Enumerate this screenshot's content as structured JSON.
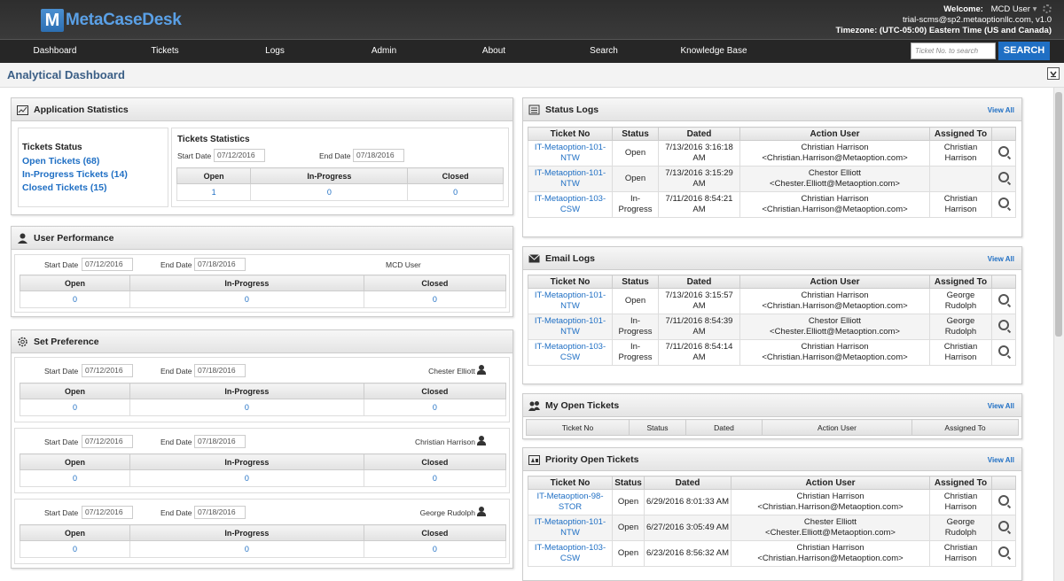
{
  "app": {
    "logo_letter": "M",
    "logo_text": "MetaCaseDesk"
  },
  "user": {
    "welcome_label": "Welcome:",
    "name": "MCD User",
    "caret": "▾",
    "tenant": "trial-scms@sp2.metaoptionllc.com, v1.0",
    "timezone": "Timezone: (UTC-05:00) Eastern Time (US and Canada)"
  },
  "nav": [
    {
      "label": "Dashboard"
    },
    {
      "label": "Tickets"
    },
    {
      "label": "Logs"
    },
    {
      "label": "Admin"
    },
    {
      "label": "About"
    },
    {
      "label": "Search"
    },
    {
      "label": "Knowledge Base"
    }
  ],
  "search": {
    "placeholder": "Ticket No. to search",
    "button": "SEARCH"
  },
  "page_title": "Analytical Dashboard",
  "app_stats": {
    "title": "Application Statistics",
    "status_title": "Tickets Status",
    "open": "Open Tickets (68)",
    "in_progress": "In-Progress Tickets (14)",
    "closed": "Closed Tickets (15)",
    "stats_title": "Tickets Statistics",
    "start_label": "Start Date",
    "start": "07/12/2016",
    "end_label": "End Date",
    "end": "07/18/2016",
    "cols": [
      "Open",
      "In-Progress",
      "Closed"
    ],
    "vals": [
      "1",
      "0",
      "0"
    ]
  },
  "user_perf": {
    "title": "User Performance",
    "start_label": "Start Date",
    "start": "07/12/2016",
    "end_label": "End Date",
    "end": "07/18/2016",
    "user": "MCD User",
    "cols": [
      "Open",
      "In-Progress",
      "Closed"
    ],
    "vals": [
      "0",
      "0",
      "0"
    ]
  },
  "set_pref": {
    "title": "Set Preference",
    "blocks": [
      {
        "start_label": "Start Date",
        "start": "07/12/2016",
        "end_label": "End Date",
        "end": "07/18/2016",
        "user": "Chester Elliott",
        "cols": [
          "Open",
          "In-Progress",
          "Closed"
        ],
        "vals": [
          "0",
          "0",
          "0"
        ]
      },
      {
        "start_label": "Start Date",
        "start": "07/12/2016",
        "end_label": "End Date",
        "end": "07/18/2016",
        "user": "Christian Harrison",
        "cols": [
          "Open",
          "In-Progress",
          "Closed"
        ],
        "vals": [
          "0",
          "0",
          "0"
        ]
      },
      {
        "start_label": "Start Date",
        "start": "07/12/2016",
        "end_label": "End Date",
        "end": "07/18/2016",
        "user": "George Rudolph",
        "cols": [
          "Open",
          "In-Progress",
          "Closed"
        ],
        "vals": [
          "0",
          "0",
          "0"
        ]
      }
    ]
  },
  "status_logs": {
    "title": "Status Logs",
    "view_all": "View All",
    "cols": [
      "Ticket No",
      "Status",
      "Dated",
      "Action User",
      "Assigned To"
    ],
    "rows": [
      {
        "ticket": "IT-Metaoption-101-NTW",
        "status": "Open",
        "dated": "7/13/2016 3:16:18 AM",
        "user": "Christian Harrison",
        "email": "<Christian.Harrison@Metaoption.com>",
        "assigned": "Christian Harrison"
      },
      {
        "ticket": "IT-Metaoption-101-NTW",
        "status": "Open",
        "dated": "7/13/2016 3:15:29 AM",
        "user": "Chestor Elliott",
        "email": "<Chester.Elliott@Metaoption.com>",
        "assigned": ""
      },
      {
        "ticket": "IT-Metaoption-103-CSW",
        "status": "In-Progress",
        "dated": "7/11/2016 8:54:21 AM",
        "user": "Christian Harrison",
        "email": "<Christian.Harrison@Metaoption.com>",
        "assigned": "Christian Harrison"
      }
    ]
  },
  "email_logs": {
    "title": "Email Logs",
    "view_all": "View All",
    "cols": [
      "Ticket No",
      "Status",
      "Dated",
      "Action User",
      "Assigned To"
    ],
    "rows": [
      {
        "ticket": "IT-Metaoption-101-NTW",
        "status": "Open",
        "dated": "7/13/2016 3:15:57 AM",
        "user": "Christian Harrison",
        "email": "<Christian.Harrison@Metaoption.com>",
        "assigned": "George Rudolph"
      },
      {
        "ticket": "IT-Metaoption-101-NTW",
        "status": "In-Progress",
        "dated": "7/11/2016 8:54:39 AM",
        "user": "Chestor Elliott",
        "email": "<Chester.Elliott@Metaoption.com>",
        "assigned": "George Rudolph"
      },
      {
        "ticket": "IT-Metaoption-103-CSW",
        "status": "In-Progress",
        "dated": "7/11/2016 8:54:14 AM",
        "user": "Christian Harrison",
        "email": "<Christian.Harrison@Metaoption.com>",
        "assigned": "Christian Harrison"
      }
    ]
  },
  "my_open": {
    "title": "My Open Tickets",
    "view_all": "View All",
    "cols": [
      "Ticket No",
      "Status",
      "Dated",
      "Action User",
      "Assigned To"
    ]
  },
  "priority": {
    "title": "Priority Open Tickets",
    "view_all": "View All",
    "cols": [
      "Ticket No",
      "Status",
      "Dated",
      "Action User",
      "Assigned To"
    ],
    "rows": [
      {
        "ticket": "IT-Metaoption-98-STOR",
        "status": "Open",
        "dated": "6/29/2016 8:01:33 AM",
        "user": "Christian Harrison",
        "email": "<Christian.Harrison@Metaoption.com>",
        "assigned": "Christian Harrison"
      },
      {
        "ticket": "IT-Metaoption-101-NTW",
        "status": "Open",
        "dated": "6/27/2016 3:05:49 AM",
        "user": "Chester Elliott",
        "email": "<Chester.Elliott@Metaoption.com>",
        "assigned": "George Rudolph"
      },
      {
        "ticket": "IT-Metaoption-103-CSW",
        "status": "Open",
        "dated": "6/23/2016 8:56:32 AM",
        "user": "Christian Harrison",
        "email": "<Christian.Harrison@Metaoption.com>",
        "assigned": "Christian Harrison"
      }
    ]
  },
  "icons": {
    "lens": "view-details-icon",
    "user": "user-icon",
    "gear": "gear-icon"
  }
}
